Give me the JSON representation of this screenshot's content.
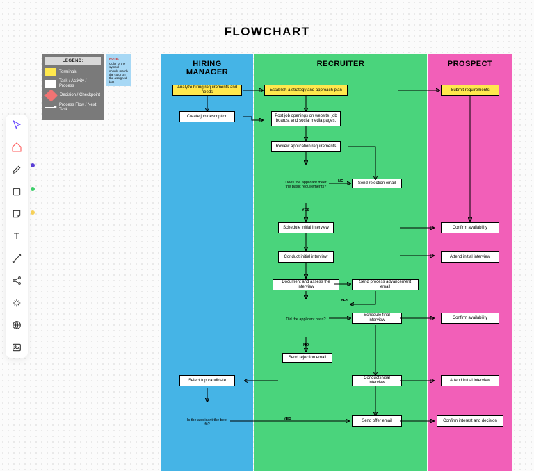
{
  "title": "FLOWCHART",
  "legend": {
    "title": "LEGEND:",
    "items": [
      {
        "label": "Terminals"
      },
      {
        "label": "Task / Activity / Process"
      },
      {
        "label": "Decision / Checkpoint"
      },
      {
        "label": "Process Flow / Next Task"
      }
    ]
  },
  "note": {
    "title": "NOTE:",
    "body": "Color of the symbol should match the color on the assigned box"
  },
  "lanes": {
    "hm": "HIRING\nMANAGER",
    "rc": "RECRUITER",
    "pr": "PROSPECT"
  },
  "nodes": {
    "hm_analyze": "Analyze hiring requirements and needs",
    "hm_create": "Create job description",
    "hm_select": "Select top candidate",
    "rc_strategy": "Establish a strategy and approach plan",
    "rc_post": "Post job openings on website, job boards, and social media pages.",
    "rc_review": "Review application requirements",
    "rc_dec1": "Does the applicant meet the basic requirements?",
    "rc_reject1": "Send rejection email",
    "rc_schedule": "Schedule initial interview",
    "rc_conduct": "Conduct initial interview",
    "rc_doc": "Document and assess the interview",
    "rc_advance": "Send process advancement email",
    "rc_dec2": "Did the applicant pass?",
    "rc_sched_final": "Schedule final interview",
    "rc_reject2": "Send rejection email",
    "rc_conduct2": "Conduct initial interview",
    "rc_offer": "Send offer email",
    "hm_dec3": "Is the applicant the best fit?",
    "pr_submit": "Submit requirements",
    "pr_conf1": "Confirm availability",
    "pr_attend1": "Attend initial interview",
    "pr_conf2": "Confirm availability",
    "pr_attend2": "Attend initial interview",
    "pr_confirm_int": "Confirm interest and decision"
  },
  "edge_labels": {
    "no": "NO",
    "yes": "YES",
    "yes2": "YES",
    "no2": "NO",
    "yes3": "YES"
  },
  "colors": {
    "dot1": "#5a3fd6",
    "dot2": "#3ecf6b",
    "dot3": "#f7d159"
  }
}
